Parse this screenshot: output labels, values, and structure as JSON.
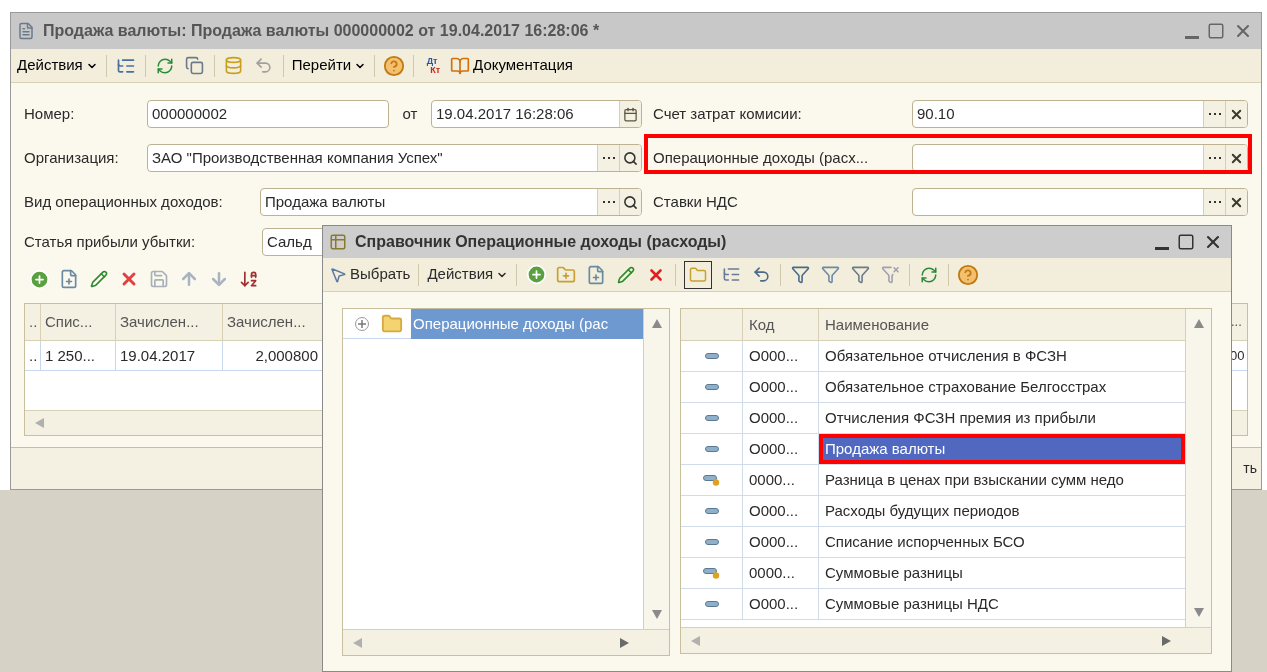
{
  "main_window": {
    "title": "Продажа валюты: Продажа валюты 000000002 от 19.04.2017 16:28:06 *",
    "toolbar": {
      "actions_menu": "Действия",
      "goto_menu": "Перейти",
      "dt_kt": {
        "debit": "Дт",
        "credit": "Кт"
      },
      "docs_button": "Документация"
    },
    "number": {
      "label": "Номер:",
      "value": "000000002"
    },
    "date": {
      "label": "от",
      "value": "19.04.2017 16:28:06"
    },
    "organization": {
      "label": "Организация:",
      "value": "ЗАО \"Производственная компания Успех\""
    },
    "income_type": {
      "label": "Вид операционных доходов:",
      "value": "Продажа валюты"
    },
    "profit_item": {
      "label": "Статья прибыли убытки:",
      "value": "Сальд"
    },
    "right_fields": [
      {
        "label": "Счет затрат комисии:",
        "value": "90.10",
        "highlighted": false
      },
      {
        "label": "Операционные доходы (расх...",
        "highlighted": true
      },
      {
        "label": "Ставки НДС",
        "highlighted": false
      }
    ],
    "table": {
      "columns": [
        "..",
        "Спис...",
        "Зачислен...",
        "Зачислен...",
        "..."
      ],
      "rows": [
        {
          "cells": [
            "..",
            "1 250...",
            "19.04.2017",
            "2,000800",
            "00"
          ]
        }
      ]
    },
    "footer_button": "ть"
  },
  "dialog": {
    "title": "Справочник Операционные доходы (расходы)",
    "toolbar": {
      "select_button": "Выбрать",
      "actions_menu": "Действия"
    },
    "tree": [
      {
        "label": "Операционные доходы (рас",
        "selected": true,
        "expanded": false
      }
    ],
    "table": {
      "columns": [
        "Код",
        "Наименование"
      ],
      "rows": [
        {
          "kind": "element",
          "code": "O000...",
          "name": "Обязательное отчисления в ФСЗН",
          "selected": false,
          "highlighted": false
        },
        {
          "kind": "element",
          "code": "O000...",
          "name": "Обязательное страхование Белгосстрах",
          "selected": false,
          "highlighted": false
        },
        {
          "kind": "element",
          "code": "O000...",
          "name": "Отчисления ФСЗН премия из прибыли",
          "selected": false,
          "highlighted": false
        },
        {
          "kind": "element",
          "code": "O000...",
          "name": "Продажа валюты",
          "selected": true,
          "highlighted": true
        },
        {
          "kind": "element_dot",
          "code": "0000...",
          "name": "Разница в ценах при взыскании сумм недо",
          "selected": false,
          "highlighted": false
        },
        {
          "kind": "element",
          "code": "O000...",
          "name": "Расходы будущих периодов",
          "selected": false,
          "highlighted": false
        },
        {
          "kind": "element",
          "code": "O000...",
          "name": "Списание испорченных БСО",
          "selected": false,
          "highlighted": false
        },
        {
          "kind": "element_dot",
          "code": "0000...",
          "name": "Суммовые разницы",
          "selected": false,
          "highlighted": false
        },
        {
          "kind": "element",
          "code": "O000...",
          "name": "Суммовые разницы НДС",
          "selected": false,
          "highlighted": false
        }
      ]
    }
  }
}
